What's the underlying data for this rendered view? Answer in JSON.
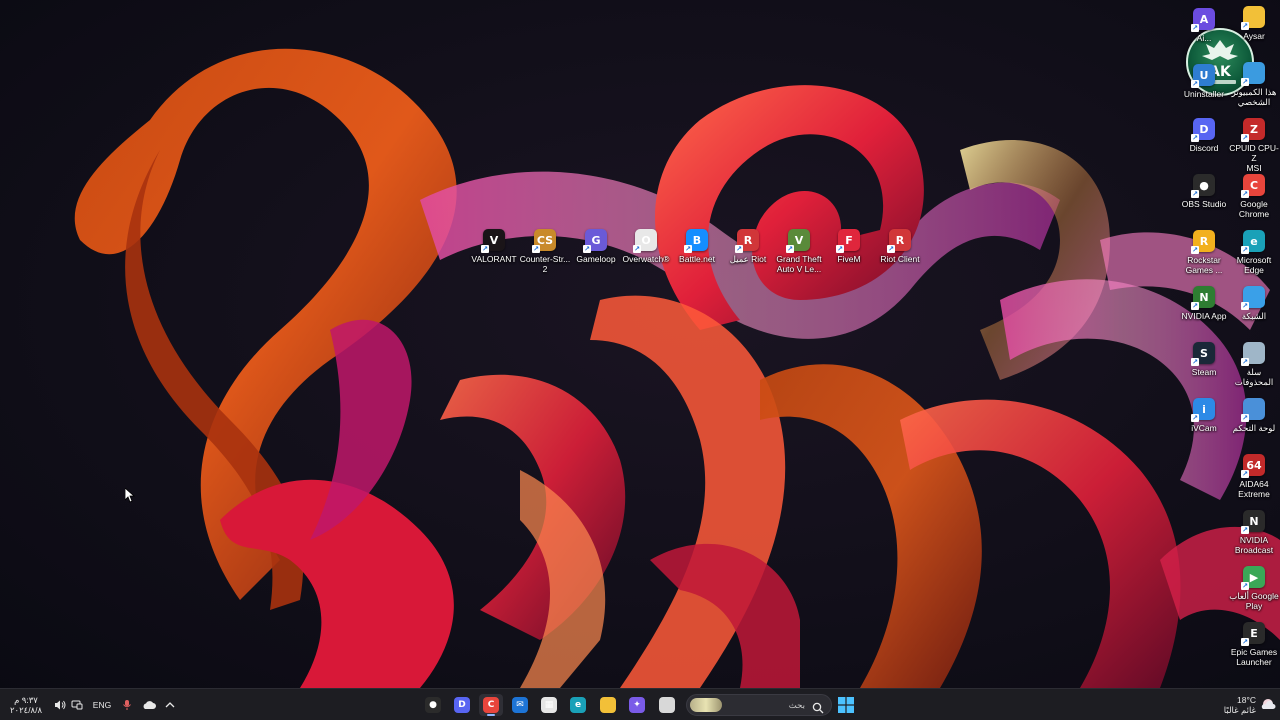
{
  "desktop": {
    "row_icons": [
      {
        "label": "VALORANT",
        "icon": "valorant-icon",
        "color": "#1a1418",
        "glyph": "V"
      },
      {
        "label": "Counter-Str...\n2",
        "icon": "counter-strike-icon",
        "color": "#c98a2a",
        "glyph": "CS"
      },
      {
        "label": "Gameloop",
        "icon": "gameloop-icon",
        "color": "#6a5ad8",
        "glyph": "G"
      },
      {
        "label": "Overwatch®",
        "icon": "overwatch-icon",
        "color": "#e8e8e8",
        "glyph": "O"
      },
      {
        "label": "Battle.net",
        "icon": "battlenet-icon",
        "color": "#148eff",
        "glyph": "B"
      },
      {
        "label": "عميل Riot",
        "icon": "riot-icon",
        "color": "#d13639",
        "glyph": "R"
      },
      {
        "label": "Grand Theft\nAuto V Le...",
        "icon": "gta-icon",
        "color": "#5a8a3a",
        "glyph": "V"
      },
      {
        "label": "FiveM",
        "icon": "fivem-icon",
        "color": "#e0263c",
        "glyph": "F"
      },
      {
        "label": "Riot Client",
        "icon": "riot-client-icon",
        "color": "#d13639",
        "glyph": "R"
      }
    ],
    "col_left": [
      {
        "label": "Ai...",
        "icon": "app-icon",
        "color": "#6b4ce0",
        "glyph": "A"
      },
      {
        "label": "Uninstaller",
        "icon": "uninstaller-icon",
        "color": "#2e7dd1",
        "glyph": "U"
      },
      {
        "label": "Discord",
        "icon": "discord-icon",
        "color": "#5865f2",
        "glyph": "D"
      },
      {
        "label": "OBS Studio",
        "icon": "obs-icon",
        "color": "#2b2b2b",
        "glyph": "●"
      },
      {
        "label": "Rockstar\nGames ...",
        "icon": "rockstar-icon",
        "color": "#f2b01e",
        "glyph": "R"
      },
      {
        "label": "NVIDIA App",
        "icon": "nvidia-icon",
        "color": "#2e7d32",
        "glyph": "N"
      },
      {
        "label": "Steam",
        "icon": "steam-icon",
        "color": "#1b2838",
        "glyph": "S"
      },
      {
        "label": "iVCam",
        "icon": "ivcam-icon",
        "color": "#2d8ae6",
        "glyph": "i"
      }
    ],
    "col_right": [
      {
        "label": "Aysar",
        "icon": "folder-icon",
        "color": "#f2c038",
        "glyph": ""
      },
      {
        "label": "هذا الكمبيوتر\nالشخصي",
        "icon": "this-pc-icon",
        "color": "#3b9be0",
        "glyph": ""
      },
      {
        "label": "CPUID CPU-Z\nMSI",
        "icon": "cpuz-icon",
        "color": "#c42a2a",
        "glyph": "Z"
      },
      {
        "label": "Google\nChrome",
        "icon": "chrome-icon",
        "color": "#e8453c",
        "glyph": "C"
      },
      {
        "label": "Microsoft\nEdge",
        "icon": "edge-icon",
        "color": "#1aa1b8",
        "glyph": "e"
      },
      {
        "label": "الشبكة",
        "icon": "network-icon",
        "color": "#3aa0e8",
        "glyph": ""
      },
      {
        "label": "سلة\nالمحذوفات",
        "icon": "recycle-bin-icon",
        "color": "#9fb6c8",
        "glyph": ""
      },
      {
        "label": "لوحة التحكم",
        "icon": "control-panel-icon",
        "color": "#4a90d9",
        "glyph": ""
      },
      {
        "label": "AIDA64\nExtreme",
        "icon": "aida64-icon",
        "color": "#c22a2a",
        "glyph": "64"
      },
      {
        "label": "NVIDIA\nBroadcast",
        "icon": "nvidia-broadcast-icon",
        "color": "#2a2a2a",
        "glyph": "N"
      },
      {
        "label": "ألعاب Google\nPlay",
        "icon": "google-play-games-icon",
        "color": "#3aa757",
        "glyph": "▶"
      },
      {
        "label": "Epic Games\nLauncher",
        "icon": "epic-games-icon",
        "color": "#2a2a2a",
        "glyph": "E"
      }
    ],
    "logo_text": "AK"
  },
  "taskbar": {
    "clock_time": "٩:٣٧ م",
    "clock_date": "٢٠٢٤/٨/٨",
    "language": "ENG",
    "search_placeholder": "بحث",
    "weather_temp": "18°C",
    "weather_desc": "غائم غالبًا",
    "apps": [
      {
        "name": "obs-taskbar-icon",
        "color": "#2b2b2b",
        "glyph": "●",
        "active": false
      },
      {
        "name": "discord-taskbar-icon",
        "color": "#5865f2",
        "glyph": "D",
        "active": false
      },
      {
        "name": "chrome-taskbar-icon",
        "color": "#e8453c",
        "glyph": "C",
        "active": true
      },
      {
        "name": "mail-taskbar-icon",
        "color": "#1d74d6",
        "glyph": "✉",
        "active": false
      },
      {
        "name": "store-taskbar-icon",
        "color": "#e6e6e6",
        "glyph": "▦",
        "active": false
      },
      {
        "name": "edge-taskbar-icon",
        "color": "#1aa1b8",
        "glyph": "e",
        "active": false
      },
      {
        "name": "file-explorer-taskbar-icon",
        "color": "#f2c038",
        "glyph": "",
        "active": false
      },
      {
        "name": "copilot-taskbar-icon",
        "color": "#7a5be8",
        "glyph": "✦",
        "active": false
      },
      {
        "name": "task-view-taskbar-icon",
        "color": "#d8d8d8",
        "glyph": "",
        "active": false
      }
    ]
  }
}
